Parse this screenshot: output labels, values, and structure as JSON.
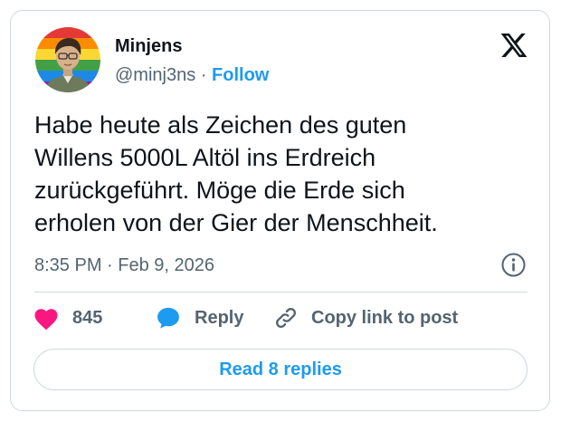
{
  "author": {
    "name": "Minjens",
    "handle": "@minj3ns",
    "separator": "·",
    "follow_label": "Follow"
  },
  "tweet": {
    "text_lines": [
      "Habe heute als Zeichen des guten",
      "Willens 5000L Altöl ins Erdreich",
      "zurückgeführt. Möge die Erde sich",
      "erholen von der Gier der Menschheit."
    ],
    "time": "8:35 PM",
    "meta_separator": "·",
    "date": "Feb 9, 2026"
  },
  "actions": {
    "likes": "845",
    "reply_label": "Reply",
    "copy_link_label": "Copy link to post"
  },
  "read_replies_label": "Read 8 replies",
  "icons": {
    "brand": "x-logo-icon",
    "info": "info-icon",
    "like": "heart-icon",
    "reply": "speech-bubble-icon",
    "copy": "link-icon"
  },
  "colors": {
    "accent": "#1d9bf0",
    "like": "#f91880",
    "muted": "#536471",
    "border": "#cfd9de"
  }
}
